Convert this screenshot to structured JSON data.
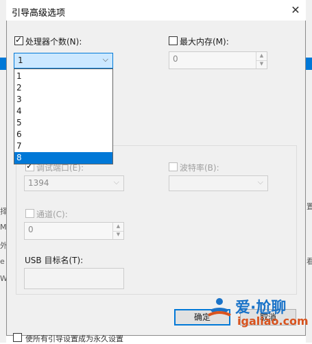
{
  "dialog": {
    "title": "引导高级选项",
    "close_glyph": "✕"
  },
  "processors": {
    "label": "处理器个数(N):",
    "checked": true,
    "selected_value": "1",
    "options": [
      "1",
      "2",
      "3",
      "4",
      "5",
      "6",
      "7",
      "8"
    ],
    "highlighted_option": "8"
  },
  "max_memory": {
    "label": "最大内存(M):",
    "checked": false,
    "value": "0"
  },
  "debug": {
    "port_label": "调试端口(E):",
    "port_checked": true,
    "port_value": "1394",
    "baud_label": "波特率(B):",
    "baud_checked": false,
    "baud_value": "",
    "channel_label": "通道(C):",
    "channel_checked": false,
    "channel_value": "0",
    "usb_label": "USB 目标名(T):",
    "usb_value": ""
  },
  "buttons": {
    "ok": "确定",
    "cancel": "取消"
  },
  "watermark": {
    "line1": "爱·尬聊",
    "line2": "igaliao.com"
  },
  "background_fragments": {
    "left": [
      "择",
      "M",
      "外",
      "e",
      "W"
    ],
    "right": [
      "置",
      "看"
    ],
    "bottom": "使所有引导设置成为永久设置"
  },
  "colors": {
    "accent": "#0078d7",
    "dialog_bg": "#f0f0f0",
    "watermark_blue": "#1a73c8",
    "watermark_orange": "#d9531e"
  }
}
